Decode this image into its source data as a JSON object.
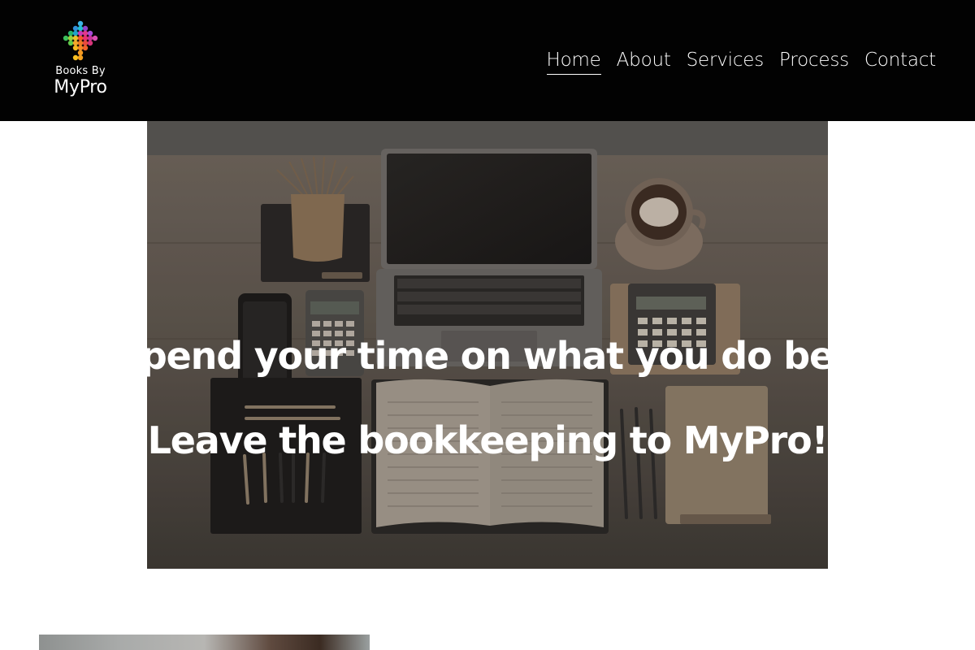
{
  "brand": {
    "line1": "Books By",
    "line2": "MyPro",
    "logo_icon": "colorful-dot-diamond-logo"
  },
  "nav": {
    "items": [
      {
        "label": "Home",
        "active": true
      },
      {
        "label": "About",
        "active": false
      },
      {
        "label": "Services",
        "active": false
      },
      {
        "label": "Process",
        "active": false
      },
      {
        "label": "Contact",
        "active": false
      }
    ]
  },
  "hero": {
    "line1": "Spend your time on what you do best",
    "line2": "Leave the bookkeeping to MyPro!",
    "image_subject": "desk-with-laptop-calculators-ledger-coffee"
  },
  "colors": {
    "header_bg": "#020202",
    "text": "#ffffff",
    "page_bg": "#ffffff"
  }
}
